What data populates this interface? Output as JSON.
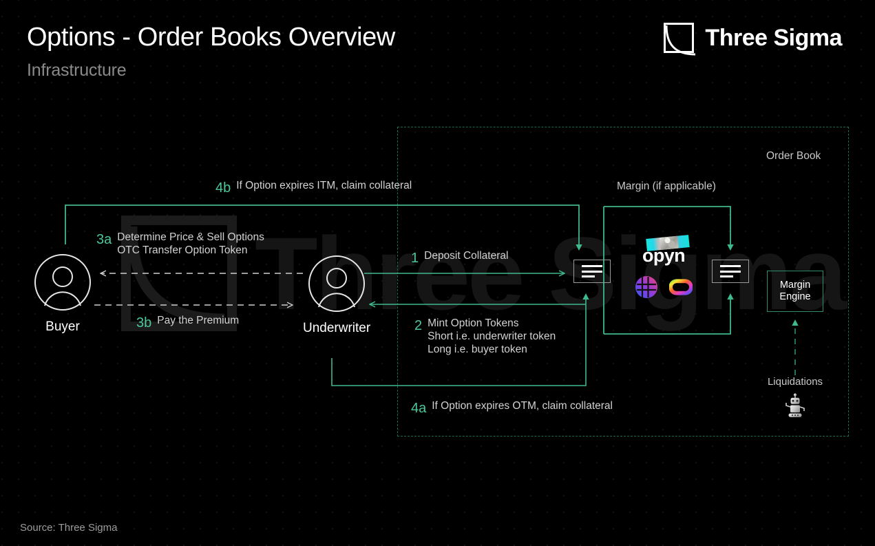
{
  "header": {
    "title": "Options - Order Books Overview",
    "subtitle": "Infrastructure"
  },
  "brand": {
    "name": "Three Sigma",
    "mark_icon": "three-sigma-square-curve-logo"
  },
  "watermark": {
    "text": "Three Sigma"
  },
  "footer": {
    "source": "Source: Three Sigma"
  },
  "regions": {
    "order_book_label": "Order Book",
    "margin_label": "Margin (if applicable)"
  },
  "actors": [
    {
      "id": "buyer",
      "label": "Buyer",
      "icon": "user-avatar-icon"
    },
    {
      "id": "underwriter",
      "label": "Underwriter",
      "icon": "user-avatar-icon"
    }
  ],
  "nodes": {
    "order_book_left_icon": "order-book-icon",
    "order_book_right_icon": "order-book-icon",
    "margin_engine": {
      "line1": "Margin",
      "line2": "Engine"
    },
    "liquidations": {
      "label": "Liquidations",
      "icon": "robot-icon"
    }
  },
  "venue": {
    "name": "opyn",
    "banner_icon": "opyn-statue-banner",
    "protocols": [
      {
        "id": "protocol-1",
        "icon": "gradient-globe-icon"
      },
      {
        "id": "protocol-2",
        "icon": "rainbow-peanut-icon"
      }
    ]
  },
  "steps": [
    {
      "id": "1",
      "num": "1",
      "lines": [
        "Deposit Collateral"
      ]
    },
    {
      "id": "2",
      "num": "2",
      "lines": [
        "Mint Option Tokens",
        "Short i.e. underwriter token",
        "Long i.e. buyer token"
      ]
    },
    {
      "id": "3a",
      "num": "3a",
      "lines": [
        "Determine Price & Sell Options",
        "OTC Transfer Option Token"
      ]
    },
    {
      "id": "3b",
      "num": "3b",
      "lines": [
        "Pay the Premium"
      ]
    },
    {
      "id": "4a",
      "num": "4a",
      "lines": [
        "If Option expires OTM, claim collateral"
      ]
    },
    {
      "id": "4b",
      "num": "4b",
      "lines": [
        "If Option expires ITM, claim collateral"
      ]
    }
  ],
  "colors": {
    "background": "#000000",
    "accent_green": "#4ec79a",
    "flow_green": "#3fb98b",
    "region_dash_green": "#1d6b4d",
    "text_primary": "#ffffff",
    "text_secondary": "#d2d2d2",
    "text_muted": "#8a8a8a"
  }
}
